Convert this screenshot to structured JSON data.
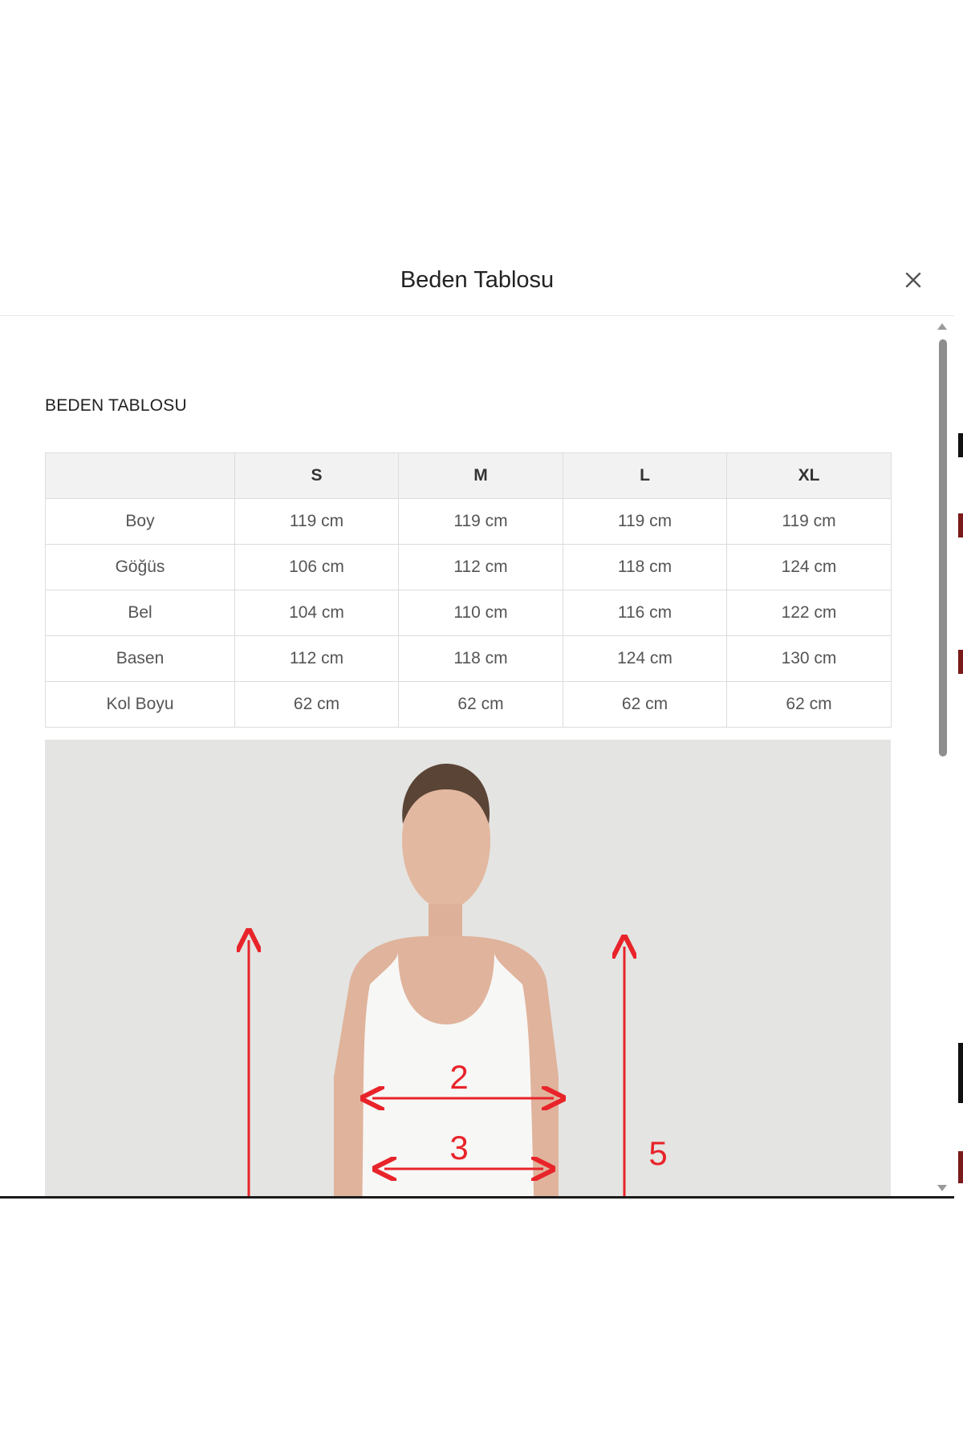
{
  "modal": {
    "title": "Beden Tablosu",
    "close_icon": "close-icon"
  },
  "section": {
    "heading": "BEDEN TABLOSU"
  },
  "size_table": {
    "columns": [
      "",
      "S",
      "M",
      "L",
      "XL"
    ],
    "rows": [
      {
        "label": "Boy",
        "values": [
          "119 cm",
          "119 cm",
          "119 cm",
          "119 cm"
        ]
      },
      {
        "label": "Göğüs",
        "values": [
          "106 cm",
          "112 cm",
          "118 cm",
          "124 cm"
        ]
      },
      {
        "label": "Bel",
        "values": [
          "104 cm",
          "110 cm",
          "116 cm",
          "122 cm"
        ]
      },
      {
        "label": "Basen",
        "values": [
          "112 cm",
          "118 cm",
          "124 cm",
          "130 cm"
        ]
      },
      {
        "label": "Kol Boyu",
        "values": [
          "62 cm",
          "62 cm",
          "62 cm",
          "62 cm"
        ]
      }
    ]
  },
  "measurement_image": {
    "labels": [
      "2",
      "3",
      "5"
    ],
    "marker_color": "#e8242a"
  },
  "colors": {
    "background": "#ffffff",
    "table_header_bg": "#f2f2f2",
    "border": "#dcdcdc"
  }
}
